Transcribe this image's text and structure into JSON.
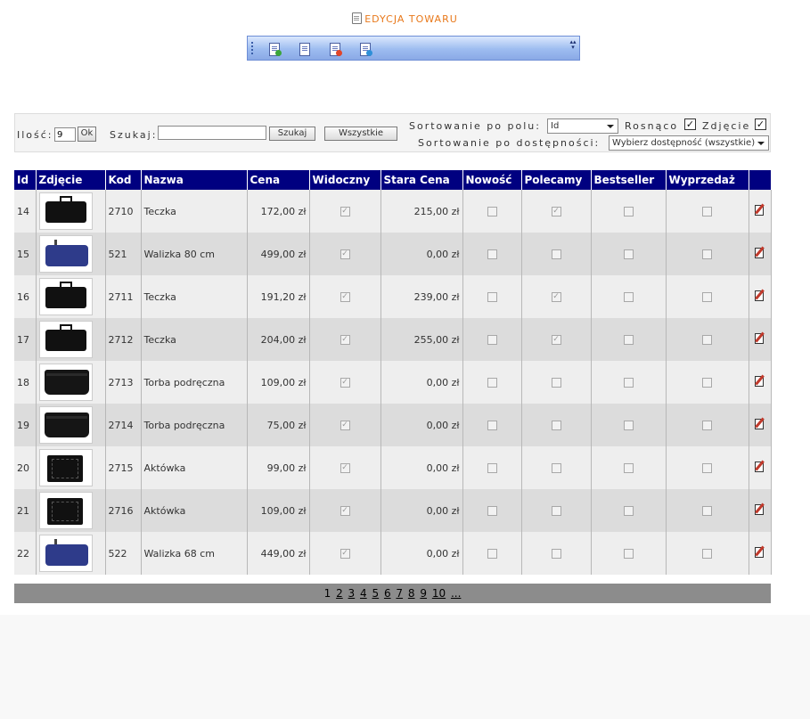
{
  "header": {
    "title": "EDYCJA TOWARU",
    "title_icon": "document-icon"
  },
  "toolbar": {
    "icons": [
      "new-document-icon",
      "edit-document-icon",
      "delete-document-icon",
      "add-document-icon"
    ],
    "chevron": "toolbar-chevron-icon"
  },
  "filters": {
    "quantity_label": "Ilość:",
    "quantity_value": "9",
    "ok_label": "Ok",
    "search_label": "Szukaj:",
    "search_value": "",
    "search_button": "Szukaj",
    "all_button": "Wszystkie",
    "sort_field_label": "Sortowanie po polu:",
    "sort_field_value": "Id",
    "ascending_label": "Rosnąco",
    "ascending_checked": true,
    "photo_label": "Zdjęcie",
    "photo_checked": true,
    "availability_label": "Sortowanie po dostępności:",
    "availability_value": "Wybierz dostępność (wszystkie)"
  },
  "table": {
    "headers": [
      "Id",
      "Zdjęcie",
      "Kod",
      "Nazwa",
      "Cena",
      "Widoczny",
      "Stara Cena",
      "Nowość",
      "Polecamy",
      "Bestseller",
      "Wyprzedaż",
      ""
    ],
    "rows": [
      {
        "id": "14",
        "image": "briefcase",
        "code": "2710",
        "name": "Teczka",
        "price": "172,00 zł",
        "visible": true,
        "old_price": "215,00 zł",
        "new": false,
        "recommended": true,
        "bestseller": false,
        "sale": false
      },
      {
        "id": "15",
        "image": "suitcase",
        "code": "521",
        "name": "Walizka 80 cm",
        "price": "499,00 zł",
        "visible": true,
        "old_price": "0,00 zł",
        "new": false,
        "recommended": false,
        "bestseller": false,
        "sale": false
      },
      {
        "id": "16",
        "image": "briefcase",
        "code": "2711",
        "name": "Teczka",
        "price": "191,20 zł",
        "visible": true,
        "old_price": "239,00 zł",
        "new": false,
        "recommended": true,
        "bestseller": false,
        "sale": false
      },
      {
        "id": "17",
        "image": "briefcase",
        "code": "2712",
        "name": "Teczka",
        "price": "204,00 zł",
        "visible": true,
        "old_price": "255,00 zł",
        "new": false,
        "recommended": true,
        "bestseller": false,
        "sale": false
      },
      {
        "id": "18",
        "image": "shoulder-bag",
        "code": "2713",
        "name": "Torba podręczna",
        "price": "109,00 zł",
        "visible": true,
        "old_price": "0,00 zł",
        "new": false,
        "recommended": false,
        "bestseller": false,
        "sale": false
      },
      {
        "id": "19",
        "image": "shoulder-bag",
        "code": "2714",
        "name": "Torba podręczna",
        "price": "75,00 zł",
        "visible": true,
        "old_price": "0,00 zł",
        "new": false,
        "recommended": false,
        "bestseller": false,
        "sale": false
      },
      {
        "id": "20",
        "image": "portfolio",
        "code": "2715",
        "name": "Aktówka",
        "price": "99,00 zł",
        "visible": true,
        "old_price": "0,00 zł",
        "new": false,
        "recommended": false,
        "bestseller": false,
        "sale": false
      },
      {
        "id": "21",
        "image": "portfolio",
        "code": "2716",
        "name": "Aktówka",
        "price": "109,00 zł",
        "visible": true,
        "old_price": "0,00 zł",
        "new": false,
        "recommended": false,
        "bestseller": false,
        "sale": false
      },
      {
        "id": "22",
        "image": "suitcase",
        "code": "522",
        "name": "Walizka 68 cm",
        "price": "449,00 zł",
        "visible": true,
        "old_price": "0,00 zł",
        "new": false,
        "recommended": false,
        "bestseller": false,
        "sale": false
      }
    ]
  },
  "pagination": {
    "current": "1",
    "pages": [
      "2",
      "3",
      "4",
      "5",
      "6",
      "7",
      "8",
      "9",
      "10",
      "..."
    ]
  },
  "colors": {
    "header_bg": "#000080",
    "accent": "#e8781a",
    "pager_bg": "#8c8c8c"
  }
}
